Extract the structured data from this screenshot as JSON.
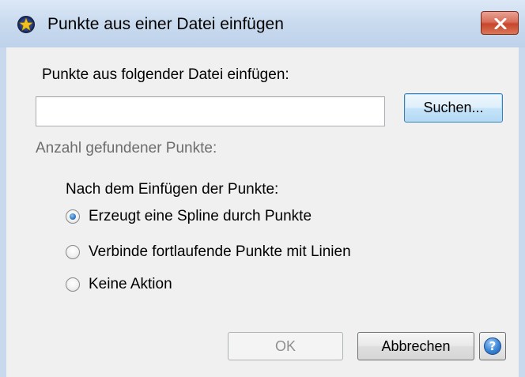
{
  "window": {
    "title": "Punkte aus einer Datei einfügen"
  },
  "file_section": {
    "label": "Punkte aus folgender Datei einfügen:",
    "path_value": "",
    "search_button": "Suchen..."
  },
  "found_points_label": "Anzahl gefundener Punkte:",
  "after_insert": {
    "label": "Nach dem Einfügen der Punkte:",
    "options": [
      {
        "label": "Erzeugt eine Spline durch Punkte",
        "checked": true
      },
      {
        "label": "Verbinde fortlaufende Punkte mit Linien",
        "checked": false
      },
      {
        "label": "Keine Aktion",
        "checked": false
      }
    ]
  },
  "buttons": {
    "ok": "OK",
    "cancel": "Abbrechen",
    "help_icon": "help-icon"
  },
  "icons": {
    "app": "app-star-icon",
    "close": "close-icon"
  },
  "colors": {
    "close_button": "#c8452c",
    "radio_accent": "#2f79c4",
    "frame": "#c8d9ee"
  }
}
